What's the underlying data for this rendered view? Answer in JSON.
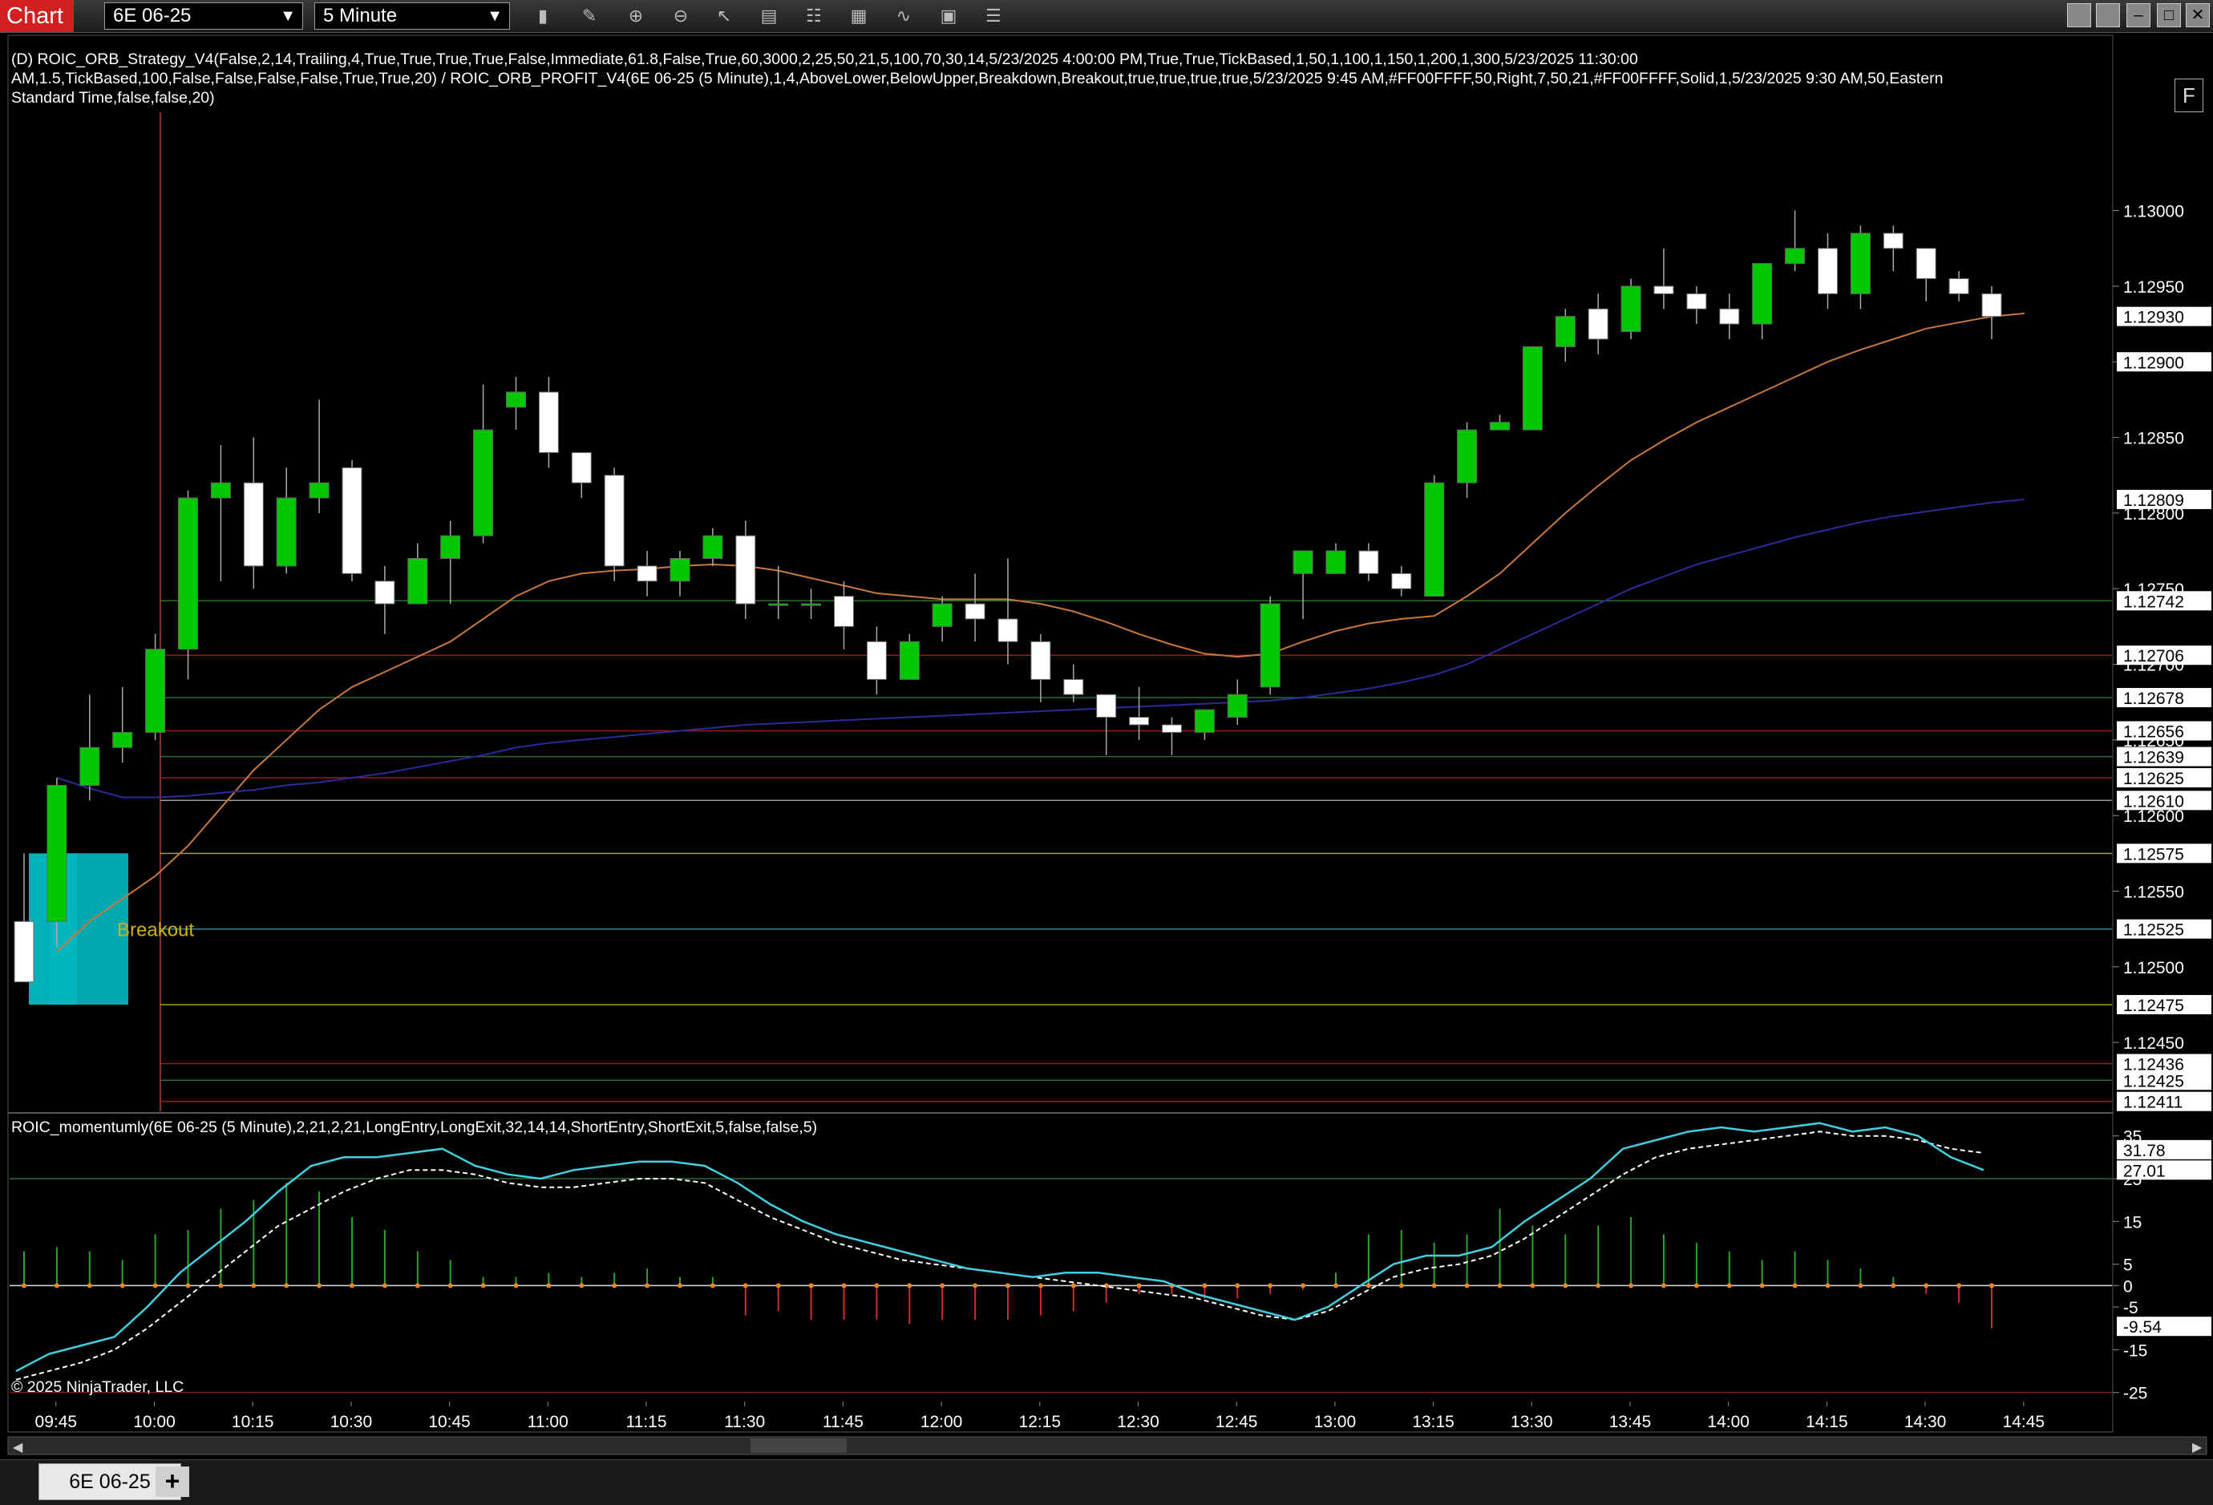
{
  "toolbar": {
    "app_title": "Chart",
    "instrument": "6E 06-25",
    "interval": "5 Minute",
    "icons": [
      "bar-type-icon",
      "draw-pencil-icon",
      "zoom-in-icon",
      "zoom-out-icon",
      "pointer-icon",
      "data-box-icon",
      "properties-icon",
      "indicators-icon",
      "strategies-icon",
      "templates-icon",
      "list-icon"
    ]
  },
  "window_buttons": [
    "restore-icon",
    "restore-icon",
    "minimize-icon",
    "maximize-icon",
    "close-icon"
  ],
  "strategy_header": {
    "line1": "(D) ROIC_ORB_Strategy_V4(False,2,14,Trailing,4,True,True,True,True,False,Immediate,61.8,False,True,60,3000,2,25,50,21,5,100,70,30,14,5/23/2025 4:00:00 PM,True,True,TickBased,1,50,1,100,1,150,1,200,1,300,5/23/2025 11:30:00",
    "line2": "AM,1.5,TickBased,100,False,False,False,False,True,True,20) / ROIC_ORB_PROFIT_V4(6E 06-25 (5 Minute),1,4,AboveLower,BelowUpper,Breakdown,Breakout,true,true,true,true,5/23/2025 9:45 AM,#FF00FFFF,50,Right,7,50,21,#FF00FFFF,Solid,1,5/23/2025 9:30 AM,50,Eastern",
    "line3": "Standard Time,false,false,20)"
  },
  "f_button": "F",
  "indicator_header": "ROIC_momentumly(6E 06-25 (5 Minute),2,21,2,21,LongEntry,LongExit,32,14,14,ShortEntry,ShortExit,5,false,false,5)",
  "copyright": "© 2025 NinjaTrader, LLC",
  "breakout_label": "Breakout",
  "tab": {
    "label": "6E 06-25",
    "add": "+"
  },
  "price_axis_ticks": [
    "1.13000",
    "1.12950",
    "1.12900",
    "1.12850",
    "1.12800",
    "1.12750",
    "1.12700",
    "1.12650",
    "1.12600",
    "1.12550",
    "1.12500",
    "1.12450"
  ],
  "price_markers": [
    {
      "label": "1.12930",
      "fill": "#ffffff"
    },
    {
      "label": "1.12900",
      "fill": "#ffffff"
    },
    {
      "label": "1.12809",
      "fill": "#ffffff"
    },
    {
      "label": "1.12742",
      "fill": "#ffffff"
    },
    {
      "label": "1.12706",
      "fill": "#ffffff"
    },
    {
      "label": "1.12678",
      "fill": "#ffffff"
    },
    {
      "label": "1.12656",
      "fill": "#ffffff"
    },
    {
      "label": "1.12639",
      "fill": "#ffffff"
    },
    {
      "label": "1.12625",
      "fill": "#ffffff"
    },
    {
      "label": "1.12610",
      "fill": "#ffffff"
    },
    {
      "label": "1.12575",
      "fill": "#ffffff"
    },
    {
      "label": "1.12525",
      "fill": "#ffffff"
    },
    {
      "label": "1.12475",
      "fill": "#ffffff"
    },
    {
      "label": "1.12436",
      "fill": "#ffffff"
    },
    {
      "label": "1.12425",
      "fill": "#ffffff"
    },
    {
      "label": "1.12411",
      "fill": "#ffffff"
    }
  ],
  "level_lines": [
    {
      "price": 1.12742,
      "color": "#2e6b2e"
    },
    {
      "price": 1.12706,
      "color": "#9b1c1c"
    },
    {
      "price": 1.12678,
      "color": "#2e6b2e"
    },
    {
      "price": 1.12656,
      "color": "#9b1c1c"
    },
    {
      "price": 1.12639,
      "color": "#2e6b2e"
    },
    {
      "price": 1.12625,
      "color": "#9b1c1c"
    },
    {
      "price": 1.1261,
      "color": "#9a9a9a"
    },
    {
      "price": 1.12575,
      "color": "#a89a2a"
    },
    {
      "price": 1.12525,
      "color": "#2a8c9a"
    },
    {
      "price": 1.12475,
      "color": "#a89a2a"
    },
    {
      "price": 1.12436,
      "color": "#9b1c1c"
    },
    {
      "price": 1.12425,
      "color": "#2e6b2e"
    },
    {
      "price": 1.12411,
      "color": "#9b1c1c"
    }
  ],
  "time_axis": [
    "09:45",
    "10:00",
    "10:15",
    "10:30",
    "10:45",
    "11:00",
    "11:15",
    "11:30",
    "11:45",
    "12:00",
    "12:15",
    "12:30",
    "12:45",
    "13:00",
    "13:15",
    "13:30",
    "13:45",
    "14:00",
    "14:15",
    "14:30",
    "14:45"
  ],
  "indicator_axis": [
    "35",
    "25",
    "15",
    "5",
    "0",
    "-5",
    "-15",
    "-25"
  ],
  "indicator_markers": [
    {
      "label": "31.78",
      "fill": "#ffffff"
    },
    {
      "label": "27.01",
      "fill": "#ffffff"
    },
    {
      "label": "-9.54",
      "fill": "#ffffff"
    }
  ],
  "colors": {
    "bull": "#00c800",
    "bear": "#ffffff",
    "ma_orange": "#c8783c",
    "ma_blue": "#2a2a9a",
    "cyan": "#40d0e0",
    "orb_box": "#00d0d8"
  },
  "chart_data": {
    "type": "candlestick",
    "instrument": "6E 06-25",
    "interval": "5 Minute",
    "ylim": [
      1.12405,
      1.13065
    ],
    "candles": [
      {
        "o": 1.1253,
        "h": 1.12575,
        "l": 1.12513,
        "c": 1.1249
      },
      {
        "o": 1.1253,
        "h": 1.12625,
        "l": 1.12513,
        "c": 1.1262
      },
      {
        "o": 1.1262,
        "h": 1.1268,
        "l": 1.1261,
        "c": 1.12645
      },
      {
        "o": 1.12645,
        "h": 1.12685,
        "l": 1.12635,
        "c": 1.12655
      },
      {
        "o": 1.12655,
        "h": 1.1272,
        "l": 1.1265,
        "c": 1.1271
      },
      {
        "o": 1.1271,
        "h": 1.12815,
        "l": 1.1269,
        "c": 1.1281
      },
      {
        "o": 1.1281,
        "h": 1.12845,
        "l": 1.12755,
        "c": 1.1282
      },
      {
        "o": 1.1282,
        "h": 1.1285,
        "l": 1.1275,
        "c": 1.12765
      },
      {
        "o": 1.12765,
        "h": 1.1283,
        "l": 1.1276,
        "c": 1.1281
      },
      {
        "o": 1.1281,
        "h": 1.12875,
        "l": 1.128,
        "c": 1.1282
      },
      {
        "o": 1.1283,
        "h": 1.12835,
        "l": 1.12755,
        "c": 1.1276
      },
      {
        "o": 1.12755,
        "h": 1.12765,
        "l": 1.1272,
        "c": 1.1274
      },
      {
        "o": 1.1274,
        "h": 1.1278,
        "l": 1.1274,
        "c": 1.1277
      },
      {
        "o": 1.1277,
        "h": 1.12795,
        "l": 1.1274,
        "c": 1.12785
      },
      {
        "o": 1.12785,
        "h": 1.12885,
        "l": 1.1278,
        "c": 1.12855
      },
      {
        "o": 1.1287,
        "h": 1.1289,
        "l": 1.12855,
        "c": 1.1288
      },
      {
        "o": 1.1288,
        "h": 1.1289,
        "l": 1.1283,
        "c": 1.1284
      },
      {
        "o": 1.1284,
        "h": 1.1283,
        "l": 1.1281,
        "c": 1.1282
      },
      {
        "o": 1.12825,
        "h": 1.1283,
        "l": 1.12755,
        "c": 1.12765
      },
      {
        "o": 1.12765,
        "h": 1.12775,
        "l": 1.12745,
        "c": 1.12755
      },
      {
        "o": 1.12755,
        "h": 1.12775,
        "l": 1.12745,
        "c": 1.1277
      },
      {
        "o": 1.1277,
        "h": 1.1279,
        "l": 1.12765,
        "c": 1.12785
      },
      {
        "o": 1.12785,
        "h": 1.12795,
        "l": 1.1273,
        "c": 1.1274
      },
      {
        "o": 1.1274,
        "h": 1.12765,
        "l": 1.1273,
        "c": 1.1274
      },
      {
        "o": 1.1274,
        "h": 1.1275,
        "l": 1.1273,
        "c": 1.1274
      },
      {
        "o": 1.12745,
        "h": 1.12755,
        "l": 1.1271,
        "c": 1.12725
      },
      {
        "o": 1.12715,
        "h": 1.12725,
        "l": 1.1268,
        "c": 1.1269
      },
      {
        "o": 1.1269,
        "h": 1.1272,
        "l": 1.1269,
        "c": 1.12715
      },
      {
        "o": 1.12725,
        "h": 1.12745,
        "l": 1.12715,
        "c": 1.1274
      },
      {
        "o": 1.1274,
        "h": 1.1276,
        "l": 1.12715,
        "c": 1.1273
      },
      {
        "o": 1.1273,
        "h": 1.1277,
        "l": 1.127,
        "c": 1.12715
      },
      {
        "o": 1.12715,
        "h": 1.1272,
        "l": 1.12675,
        "c": 1.1269
      },
      {
        "o": 1.1269,
        "h": 1.127,
        "l": 1.12675,
        "c": 1.1268
      },
      {
        "o": 1.1268,
        "h": 1.1268,
        "l": 1.1264,
        "c": 1.12665
      },
      {
        "o": 1.12665,
        "h": 1.12685,
        "l": 1.1265,
        "c": 1.1266
      },
      {
        "o": 1.1266,
        "h": 1.12665,
        "l": 1.1264,
        "c": 1.12655
      },
      {
        "o": 1.12655,
        "h": 1.1267,
        "l": 1.1265,
        "c": 1.1267
      },
      {
        "o": 1.12665,
        "h": 1.1269,
        "l": 1.1266,
        "c": 1.1268
      },
      {
        "o": 1.12685,
        "h": 1.12745,
        "l": 1.1268,
        "c": 1.1274
      },
      {
        "o": 1.1276,
        "h": 1.12775,
        "l": 1.1273,
        "c": 1.12775
      },
      {
        "o": 1.1276,
        "h": 1.1278,
        "l": 1.1276,
        "c": 1.12775
      },
      {
        "o": 1.12775,
        "h": 1.1278,
        "l": 1.12755,
        "c": 1.1276
      },
      {
        "o": 1.1276,
        "h": 1.12765,
        "l": 1.12745,
        "c": 1.1275
      },
      {
        "o": 1.12745,
        "h": 1.12825,
        "l": 1.12745,
        "c": 1.1282
      },
      {
        "o": 1.1282,
        "h": 1.1286,
        "l": 1.1281,
        "c": 1.12855
      },
      {
        "o": 1.12855,
        "h": 1.12865,
        "l": 1.12855,
        "c": 1.1286
      },
      {
        "o": 1.12855,
        "h": 1.1291,
        "l": 1.12855,
        "c": 1.1291
      },
      {
        "o": 1.1291,
        "h": 1.12935,
        "l": 1.129,
        "c": 1.1293
      },
      {
        "o": 1.12935,
        "h": 1.12945,
        "l": 1.12905,
        "c": 1.12915
      },
      {
        "o": 1.1292,
        "h": 1.12955,
        "l": 1.12915,
        "c": 1.1295
      },
      {
        "o": 1.1295,
        "h": 1.12975,
        "l": 1.12935,
        "c": 1.12945
      },
      {
        "o": 1.12945,
        "h": 1.1295,
        "l": 1.12925,
        "c": 1.12935
      },
      {
        "o": 1.12935,
        "h": 1.12945,
        "l": 1.12915,
        "c": 1.12925
      },
      {
        "o": 1.12925,
        "h": 1.12965,
        "l": 1.12915,
        "c": 1.12965
      },
      {
        "o": 1.12965,
        "h": 1.13,
        "l": 1.1296,
        "c": 1.12975
      },
      {
        "o": 1.12975,
        "h": 1.12985,
        "l": 1.12935,
        "c": 1.12945
      },
      {
        "o": 1.12945,
        "h": 1.1299,
        "l": 1.12935,
        "c": 1.12985
      },
      {
        "o": 1.12985,
        "h": 1.1299,
        "l": 1.1296,
        "c": 1.12975
      },
      {
        "o": 1.12975,
        "h": 1.12955,
        "l": 1.1294,
        "c": 1.12955
      },
      {
        "o": 1.12955,
        "h": 1.1296,
        "l": 1.1294,
        "c": 1.12945
      },
      {
        "o": 1.12945,
        "h": 1.1295,
        "l": 1.12915,
        "c": 1.1293
      }
    ],
    "ma_orange": [
      1.1251,
      1.1253,
      1.12545,
      1.1256,
      1.1258,
      1.12605,
      1.1263,
      1.1265,
      1.1267,
      1.12685,
      1.12695,
      1.12705,
      1.12715,
      1.1273,
      1.12745,
      1.12755,
      1.1276,
      1.12762,
      1.12763,
      1.12765,
      1.12766,
      1.12765,
      1.12762,
      1.12757,
      1.12752,
      1.12747,
      1.12745,
      1.12743,
      1.12743,
      1.12743,
      1.1274,
      1.12735,
      1.12728,
      1.1272,
      1.12713,
      1.12707,
      1.12705,
      1.12707,
      1.12715,
      1.12722,
      1.12727,
      1.1273,
      1.12732,
      1.12745,
      1.1276,
      1.1278,
      1.128,
      1.12818,
      1.12835,
      1.12848,
      1.1286,
      1.1287,
      1.1288,
      1.1289,
      1.129,
      1.12908,
      1.12915,
      1.12922,
      1.12926,
      1.1293,
      1.12932
    ],
    "ma_blue": [
      1.12625,
      1.12618,
      1.12612,
      1.12612,
      1.12613,
      1.12615,
      1.12617,
      1.1262,
      1.12622,
      1.12625,
      1.12628,
      1.12632,
      1.12636,
      1.1264,
      1.12645,
      1.12648,
      1.1265,
      1.12652,
      1.12654,
      1.12656,
      1.12658,
      1.1266,
      1.12661,
      1.12662,
      1.12663,
      1.12664,
      1.12665,
      1.12666,
      1.12667,
      1.12668,
      1.12669,
      1.1267,
      1.12671,
      1.12672,
      1.12673,
      1.12674,
      1.12675,
      1.12676,
      1.12678,
      1.12681,
      1.12684,
      1.12688,
      1.12693,
      1.127,
      1.1271,
      1.1272,
      1.1273,
      1.1274,
      1.1275,
      1.12758,
      1.12766,
      1.12772,
      1.12778,
      1.12784,
      1.12789,
      1.12794,
      1.12798,
      1.12801,
      1.12804,
      1.12807,
      1.12809
    ],
    "indicator": {
      "name": "ROIC_momentumly",
      "ylim": [
        -26,
        40
      ],
      "fast": [
        -20,
        -16,
        -14,
        -12,
        -5,
        3,
        9,
        15,
        22,
        28,
        30,
        30,
        31,
        32,
        28,
        26,
        25,
        27,
        28,
        29,
        29,
        28,
        24,
        19,
        15,
        12,
        10,
        8,
        6,
        4,
        3,
        2,
        3,
        3,
        2,
        1,
        -2,
        -4,
        -6,
        -8,
        -5,
        0,
        5,
        7,
        7,
        9,
        15,
        20,
        25,
        32,
        34,
        36,
        37,
        36,
        37,
        38,
        36,
        37,
        35,
        30,
        27
      ],
      "slow": [
        -22,
        -20,
        -18,
        -15,
        -10,
        -4,
        2,
        8,
        14,
        18,
        22,
        25,
        27,
        27,
        26,
        24,
        23,
        23,
        24,
        25,
        25,
        24,
        20,
        16,
        13,
        10,
        8,
        6,
        5,
        4,
        3,
        2,
        1,
        0,
        -1,
        -2,
        -3,
        -5,
        -7,
        -8,
        -6,
        -2,
        2,
        4,
        5,
        7,
        11,
        16,
        21,
        26,
        30,
        32,
        33,
        34,
        35,
        36,
        35,
        35,
        34,
        32,
        31
      ],
      "histogram": [
        8,
        9,
        8,
        6,
        12,
        13,
        18,
        20,
        24,
        22,
        16,
        13,
        8,
        6,
        2,
        2,
        3,
        2,
        3,
        4,
        2,
        2,
        -7,
        -6,
        -8,
        -8,
        -8,
        -9,
        -8,
        -8,
        -8,
        -7,
        -6,
        -4,
        -2,
        -2,
        -3,
        -3,
        -2,
        -1,
        3,
        12,
        13,
        10,
        12,
        18,
        14,
        12,
        14,
        16,
        12,
        10,
        8,
        6,
        8,
        6,
        4,
        2,
        -2,
        -4,
        -10
      ]
    }
  }
}
